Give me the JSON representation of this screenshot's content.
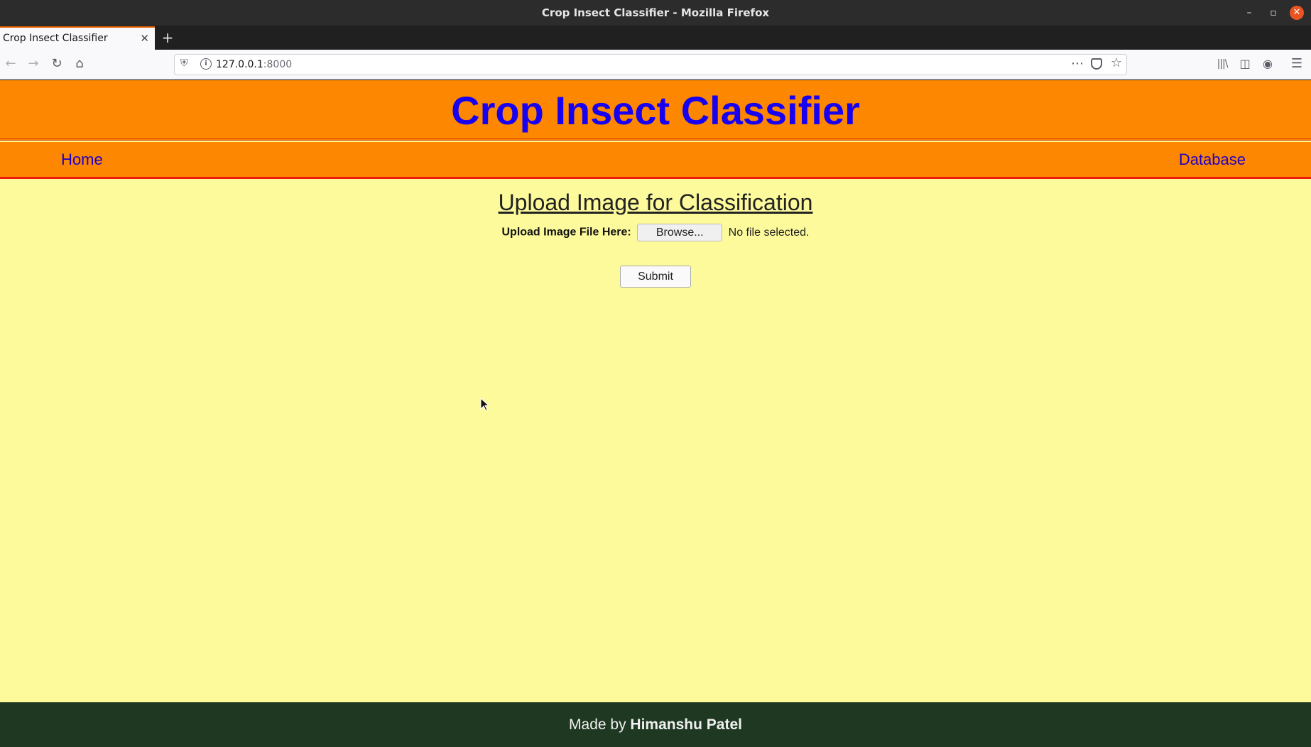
{
  "window": {
    "title": "Crop Insect Classifier - Mozilla Firefox",
    "minimize_icon": "minimize-icon",
    "maximize_icon": "maximize-icon",
    "close_icon": "close-icon"
  },
  "tabs": [
    {
      "title": "Crop Insect Classifier",
      "active": true
    }
  ],
  "new_tab_label": "+",
  "navbar": {
    "url_host": "127.0.0.1",
    "url_port": ":8000"
  },
  "site": {
    "title": "Crop Insect Classifier",
    "nav": {
      "home": "Home",
      "database": "Database"
    },
    "upload_heading": "Upload Image for Classification",
    "upload_label": "Upload Image File Here:",
    "browse_label": "Browse...",
    "file_status": "No file selected.",
    "submit_label": "Submit",
    "footer_prefix": "Made by ",
    "footer_author": "Himanshu Patel"
  },
  "colors": {
    "header_bg": "#fd8700",
    "title_color": "#1800f0",
    "page_bg": "#fdfa9b",
    "footer_bg": "#1f3822",
    "nav_border": "#ed1a0e"
  }
}
